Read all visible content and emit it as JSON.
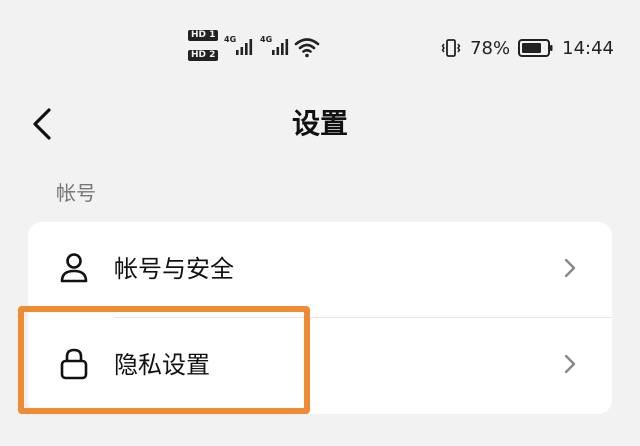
{
  "status_bar": {
    "hd1": "HD 1",
    "hd2": "HD 2",
    "network1": "4G",
    "network2": "4G",
    "battery_percent": "78%",
    "time": "14:44"
  },
  "header": {
    "title": "设置"
  },
  "sections": [
    {
      "title": "帐号",
      "items": [
        {
          "label": "帐号与安全",
          "icon": "person-icon"
        },
        {
          "label": "隐私设置",
          "icon": "lock-icon"
        }
      ]
    }
  ],
  "colors": {
    "background": "#f2f2f2",
    "card": "#ffffff",
    "highlight": "#f08a33"
  }
}
